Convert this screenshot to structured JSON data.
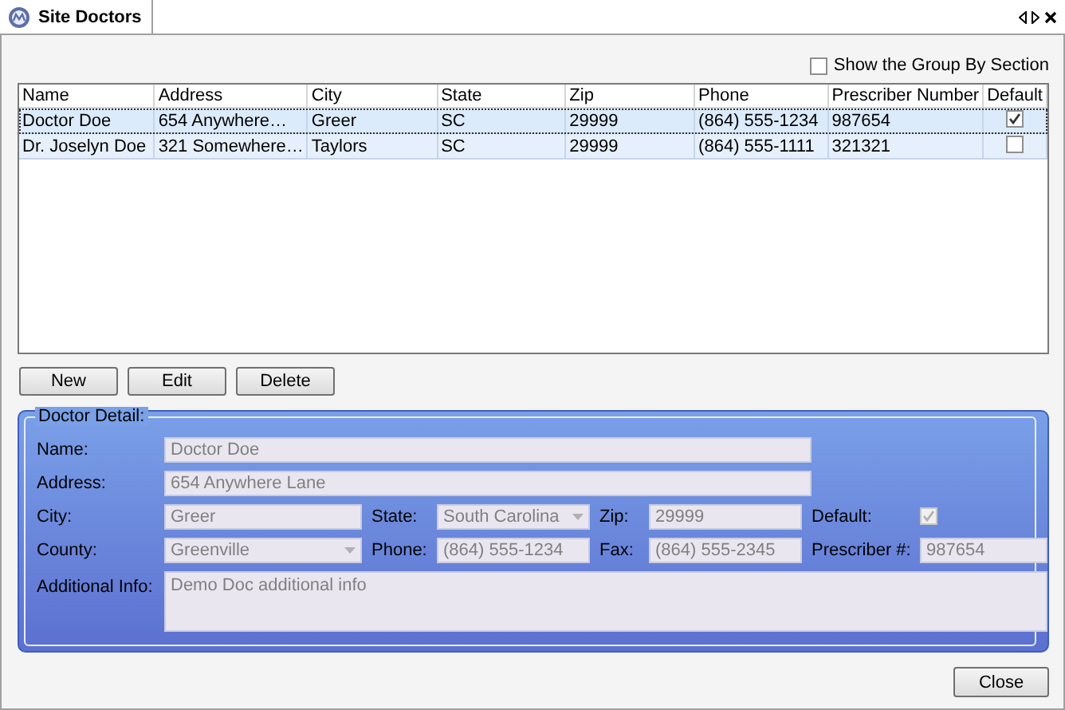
{
  "tab": {
    "title": "Site Doctors"
  },
  "show_group_by": {
    "label": "Show the Group By Section",
    "checked": false
  },
  "table": {
    "columns": [
      "Name",
      "Address",
      "City",
      "State",
      "Zip",
      "Phone",
      "Prescriber Number",
      "Default"
    ],
    "rows": [
      {
        "cells": [
          "Doctor Doe",
          "654  Anywhere…",
          "Greer",
          "SC",
          "29999",
          "(864) 555-1234",
          "987654"
        ],
        "default": true,
        "selected": true
      },
      {
        "cells": [
          "Dr. Joselyn Doe",
          "321  Somewhere…",
          "Taylors",
          "SC",
          "29999",
          "(864) 555-1111",
          "321321"
        ],
        "default": false,
        "selected": false
      }
    ]
  },
  "buttons": [
    "New",
    "Edit",
    "Delete"
  ],
  "detail": {
    "title": "Doctor Detail:",
    "name": {
      "label": "Name:",
      "value": "Doctor Doe"
    },
    "address": {
      "label": "Address:",
      "value": "654 Anywhere Lane"
    },
    "city": {
      "label": "City:",
      "value": "Greer"
    },
    "state": {
      "label": "State:",
      "value": "South Carolina"
    },
    "zip": {
      "label": "Zip:",
      "value": "29999"
    },
    "default": {
      "label": "Default:",
      "checked": true
    },
    "county": {
      "label": "County:",
      "value": "Greenville"
    },
    "phone": {
      "label": "Phone:",
      "value": "(864) 555-1234"
    },
    "fax": {
      "label": "Fax:",
      "value": "(864) 555-2345"
    },
    "prescriber": {
      "label": "Prescriber #:",
      "value": "987654"
    },
    "additional_info": {
      "label": "Additional Info:",
      "value": "Demo Doc additional info"
    }
  },
  "close_button": "Close"
}
